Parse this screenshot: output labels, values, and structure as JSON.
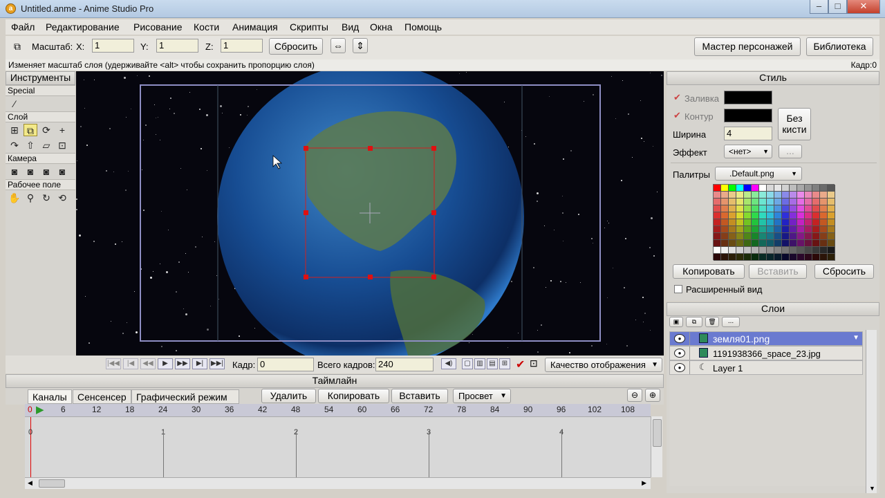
{
  "window": {
    "title": "Untitled.anme - Anime Studio Pro"
  },
  "menu": [
    "Файл",
    "Редактирование",
    "Рисование",
    "Кости",
    "Анимация",
    "Скрипты",
    "Вид",
    "Окна",
    "Помощь"
  ],
  "toolbar": {
    "scale_label": "Масштаб:",
    "x_label": "X:",
    "x_value": "1",
    "y_label": "Y:",
    "y_value": "1",
    "z_label": "Z:",
    "z_value": "1",
    "reset_label": "Сбросить",
    "character_wizard_label": "Мастер персонажей",
    "library_label": "Библиотека"
  },
  "status": {
    "message": "Изменяет масштаб слоя (удерживайте <alt> чтобы сохранить пропорцию слоя)",
    "frame": "Кадр:0"
  },
  "tools_panel": {
    "title": "Инструменты",
    "sections": [
      "Special",
      "Слой",
      "Камера",
      "Рабочее поле"
    ]
  },
  "playback": {
    "frame_label": "Кадр:",
    "frame_value": "0",
    "total_label": "Всего кадров:",
    "total_value": "240",
    "quality_label": "Качество отображения"
  },
  "timeline": {
    "title": "Таймлайн",
    "tabs": [
      "Каналы",
      "Сенсенсер",
      "Графический режим"
    ],
    "delete_label": "Удалить",
    "copy_label": "Копировать",
    "paste_label": "Вставить",
    "preview_label": "Просвет",
    "ruler": [
      "0",
      "6",
      "12",
      "18",
      "24",
      "30",
      "36",
      "42",
      "48",
      "54",
      "60",
      "66",
      "72",
      "78",
      "84",
      "90",
      "96",
      "102",
      "108"
    ],
    "seconds": [
      "0",
      "1",
      "2",
      "3",
      "4"
    ]
  },
  "style": {
    "title": "Стиль",
    "fill_label": "Заливка",
    "stroke_label": "Контур",
    "width_label": "Ширина",
    "width_value": "4",
    "no_brush_label": "Без кисти",
    "effect_label": "Эффект",
    "effect_value": "<нет>",
    "palettes_label": "Палитры",
    "palette_value": ".Default.png",
    "copy_label": "Копировать",
    "paste_label": "Вставить",
    "reset_label": "Сбросить",
    "extended_label": "Расширенный вид",
    "fill_color": "#000000",
    "stroke_color": "#000000"
  },
  "layers": {
    "title": "Слои",
    "items": [
      {
        "name": "земля01.png",
        "selected": true
      },
      {
        "name": "1191938366_space_23.jpg",
        "selected": false
      },
      {
        "name": "Layer 1",
        "selected": false
      }
    ]
  }
}
